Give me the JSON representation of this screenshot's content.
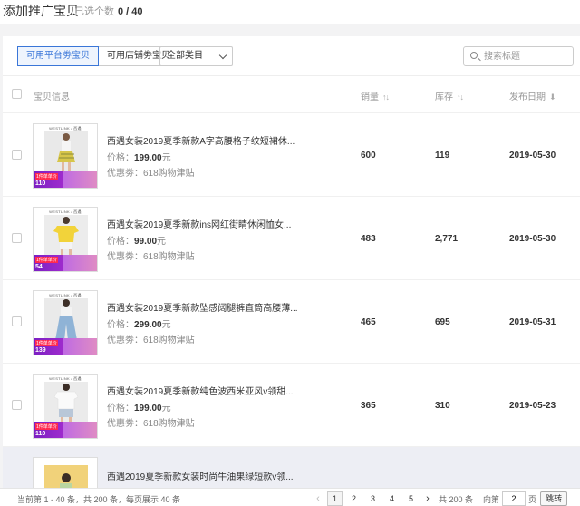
{
  "header": {
    "title": "添加推广宝贝",
    "selected_label": "已选个数",
    "selected_count": "0 / 40"
  },
  "toolbar": {
    "tabs": [
      {
        "label": "可用平台劵宝贝",
        "active": true
      },
      {
        "label": "可用店铺劵宝贝",
        "active": false
      }
    ],
    "category_select": "全部类目",
    "search_placeholder": "搜索标题"
  },
  "table": {
    "headers": {
      "info": "宝贝信息",
      "sales": "销量",
      "stock": "库存",
      "date": "发布日期"
    },
    "price_label": "价格：",
    "price_unit": "元",
    "coupon_label": "优惠劵：",
    "rows": [
      {
        "title": "西遇女装2019夏季新款A字高腰格子纹短裙休...",
        "price": "199.00",
        "coupon": "618购物津贴",
        "sales": "600",
        "stock": "119",
        "date": "2019-05-30",
        "badge_price": "110",
        "photo": "plaid-skirt-outfit"
      },
      {
        "title": "西遇女装2019夏季新款ins网红街睛休闲恤女...",
        "price": "99.00",
        "coupon": "618购物津贴",
        "sales": "483",
        "stock": "2,771",
        "date": "2019-05-30",
        "badge_price": "54",
        "photo": "yellow-tshirt-outfit"
      },
      {
        "title": "西遇女装2019夏季新款坠感阔腿裤直筒高腰薄...",
        "price": "299.00",
        "coupon": "618购物津贴",
        "sales": "465",
        "stock": "695",
        "date": "2019-05-31",
        "badge_price": "139",
        "photo": "wide-leg-jeans-outfit"
      },
      {
        "title": "西遇女装2019夏季新款纯色波西米亚风v领甜...",
        "price": "199.00",
        "coupon": "618购物津贴",
        "sales": "365",
        "stock": "310",
        "date": "2019-05-23",
        "badge_price": "110",
        "photo": "white-top-outfit"
      }
    ],
    "partial_row": {
      "title": "西遇2019夏季新款女装时尚牛油果绿短款v领..."
    }
  },
  "thumb": {
    "brand": "WESTLINK / 西遇",
    "tag": "1件单单价"
  },
  "footer": {
    "summary": "当前第 1 - 40 条，共 200 条，每页展示 40 条",
    "prev": "‹",
    "next": "›",
    "pages": [
      "1",
      "2",
      "3",
      "4",
      "5"
    ],
    "current_page": "1",
    "total": "共 200 条",
    "goto_label": "向第",
    "goto_value": "2",
    "page_unit": "页",
    "jump_button": "跳转"
  },
  "colors": {
    "accent": "#3a76d8",
    "promo_purple": "#7b1fc3",
    "band_gray": "#f3f3f4"
  }
}
